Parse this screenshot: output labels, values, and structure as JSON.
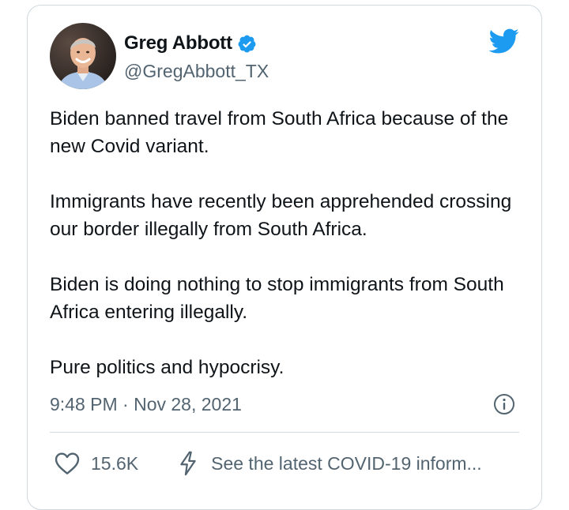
{
  "tweet": {
    "author": {
      "display_name": "Greg Abbott",
      "handle": "@GregAbbott_TX",
      "verified_icon": "verified-badge-icon",
      "avatar": "profile-photo"
    },
    "paragraphs": [
      "Biden banned travel from South Africa because of the new Covid variant.",
      "Immigrants have recently been apprehended crossing our border illegally from South Africa.",
      "Biden is doing nothing to stop immigrants from South Africa entering illegally.",
      "Pure politics and hypocrisy."
    ],
    "timestamp": "9:48 PM · Nov 28, 2021",
    "likes": "15.6K",
    "covid_link": "See the latest COVID-19 inform..."
  },
  "icons": {
    "brand": "twitter-bird-icon",
    "info": "info-icon",
    "like": "heart-icon",
    "covid": "lightning-bolt-icon"
  },
  "colors": {
    "brand_blue": "#1d9bf0",
    "text_primary": "#0f1419",
    "text_secondary": "#536471",
    "border": "#cfd9de"
  }
}
